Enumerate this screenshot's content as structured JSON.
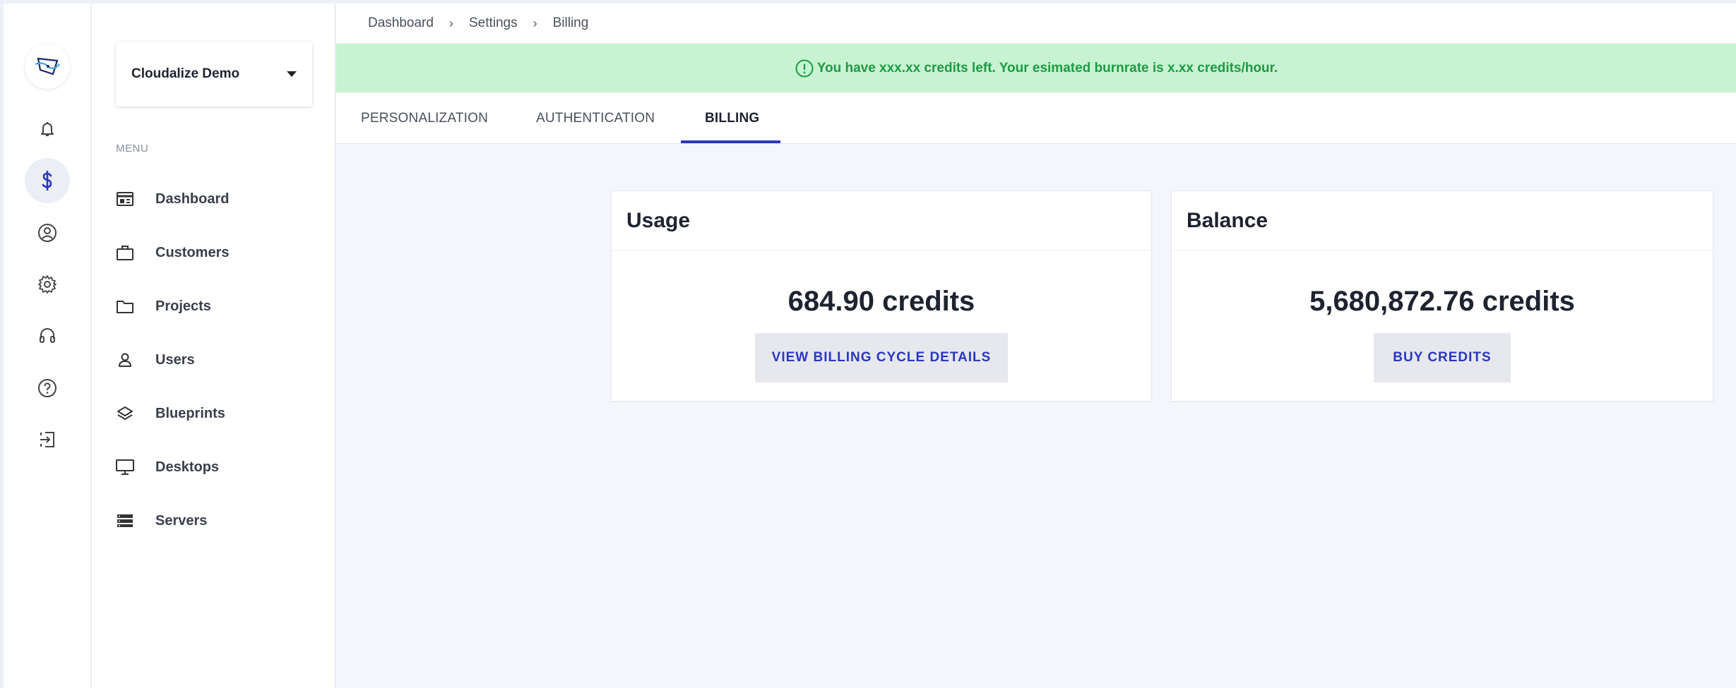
{
  "breadcrumb": [
    "Dashboard",
    "Settings",
    "Billing"
  ],
  "breadcrumb_separator": ">",
  "alert": {
    "message": "You have xxx.xx credits left. Your esimated burnrate is x.xx credits/hour.",
    "color": "#1e9a45",
    "background": "#c8f3d2"
  },
  "rail": {
    "icons": [
      "bell-icon",
      "dollar-icon",
      "user-circle-icon",
      "gear-icon",
      "headset-icon",
      "help-icon",
      "logout-icon"
    ],
    "active": "dollar-icon"
  },
  "sidebar": {
    "org_name": "Cloudalize Demo",
    "menu_heading": "MENU",
    "items": [
      {
        "label": "Dashboard",
        "icon": "dashboard-icon"
      },
      {
        "label": "Customers",
        "icon": "briefcase-icon"
      },
      {
        "label": "Projects",
        "icon": "folder-icon"
      },
      {
        "label": "Users",
        "icon": "user-icon"
      },
      {
        "label": "Blueprints",
        "icon": "layers-icon"
      },
      {
        "label": "Desktops",
        "icon": "monitor-icon"
      },
      {
        "label": "Servers",
        "icon": "server-icon"
      }
    ]
  },
  "tabs": [
    {
      "label": "PERSONALIZATION"
    },
    {
      "label": "AUTHENTICATION"
    },
    {
      "label": "BILLING"
    }
  ],
  "active_tab": "BILLING",
  "usage": {
    "title": "Usage",
    "value": "684.90 credits",
    "button": "VIEW BILLING CYCLE DETAILS"
  },
  "balance": {
    "title": "Balance",
    "value": "5,680,872.76 credits",
    "button": "BUY CREDITS"
  },
  "colors": {
    "accent": "#2a37c0",
    "background": "#f5f6fb"
  }
}
